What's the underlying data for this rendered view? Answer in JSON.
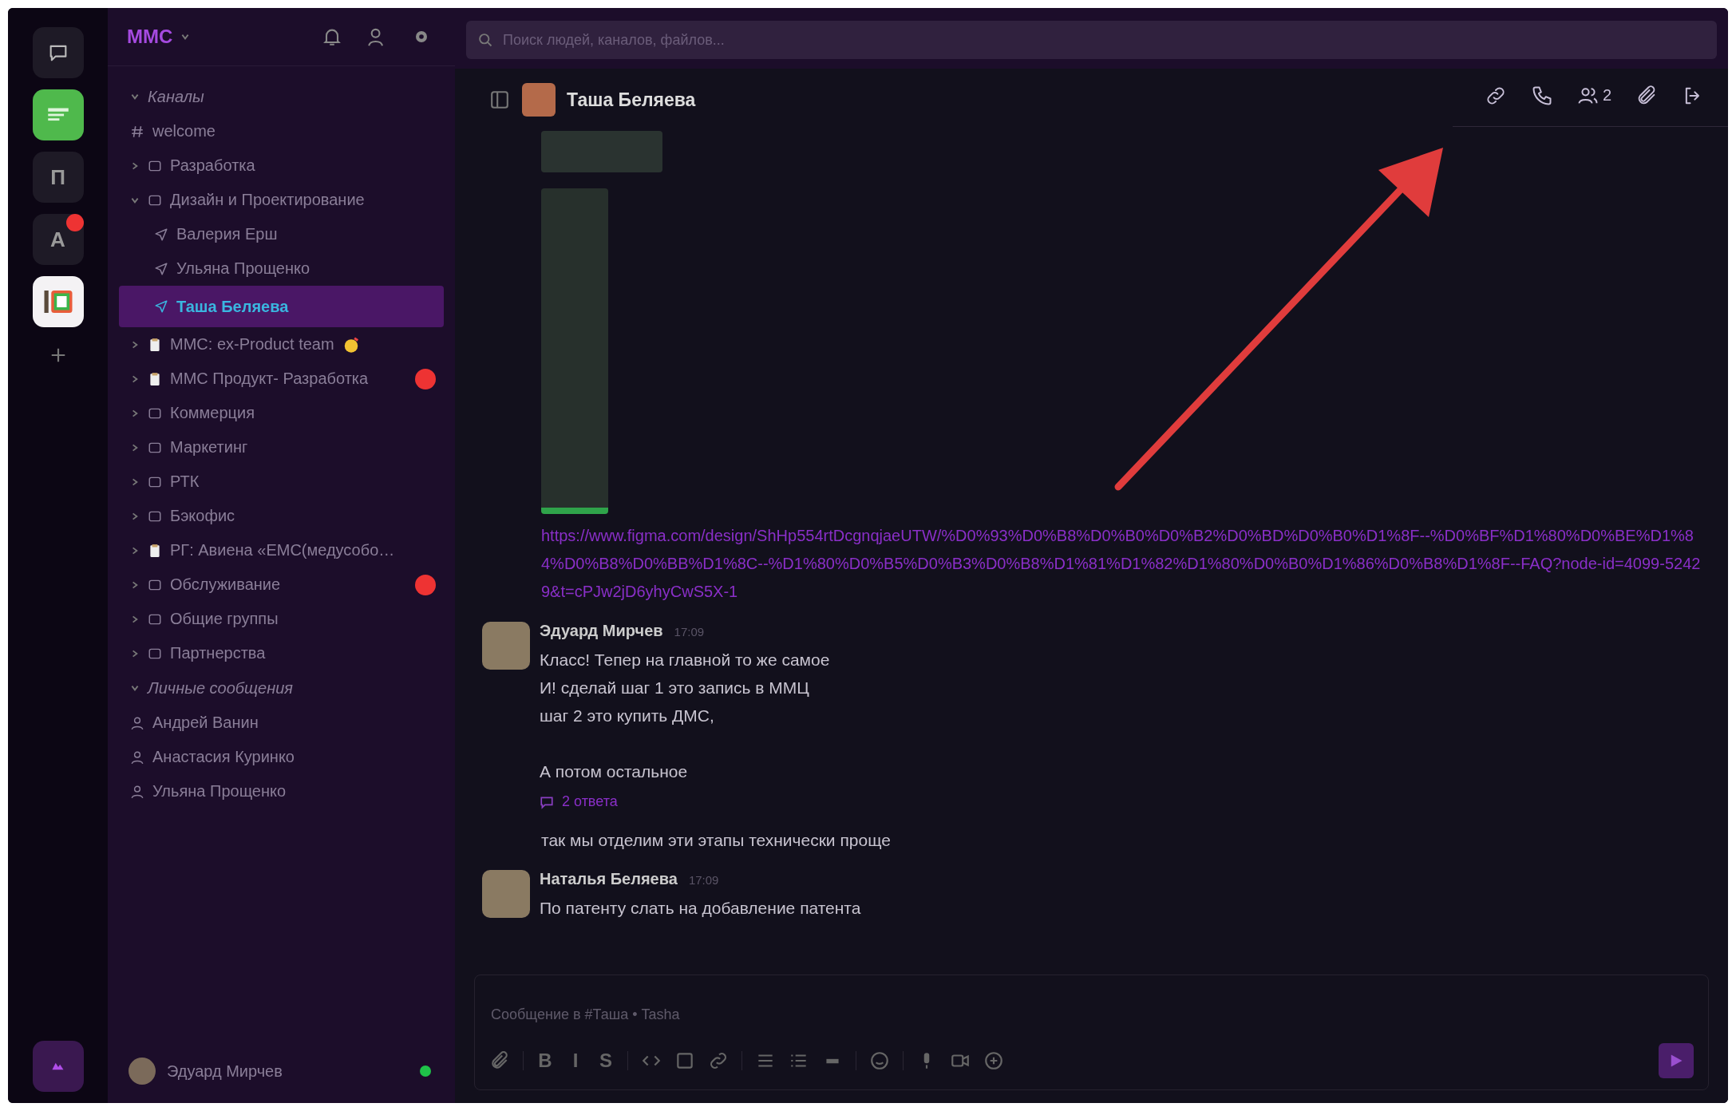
{
  "rail": {
    "items": [
      {
        "kind": "chat",
        "badge": false
      },
      {
        "kind": "green-app",
        "badge": false
      },
      {
        "kind": "letter",
        "label": "П",
        "badge": false
      },
      {
        "kind": "letter",
        "label": "A",
        "badge": true
      },
      {
        "kind": "color-app",
        "badge": false
      },
      {
        "kind": "add",
        "badge": false
      }
    ]
  },
  "sidebar": {
    "team": "MMC",
    "sections": [
      {
        "title": "Каналы",
        "expanded": true,
        "items": [
          {
            "kind": "channel",
            "label": "welcome",
            "selected": false,
            "badge": false,
            "emoji": false
          },
          {
            "kind": "folder",
            "label": "Разработка",
            "expanded": false,
            "selected": false,
            "badge": false,
            "emoji": false
          },
          {
            "kind": "folder",
            "label": "Дизайн и Проектирование",
            "expanded": true,
            "selected": false,
            "badge": false,
            "emoji": false,
            "children": [
              {
                "kind": "dm",
                "label": "Валерия Ерш",
                "selected": false,
                "badge": false,
                "emoji": false
              },
              {
                "kind": "dm",
                "label": "Ульяна Прощенко",
                "selected": false,
                "badge": false,
                "emoji": false
              },
              {
                "kind": "dm",
                "label": "Таша Беляева",
                "selected": true,
                "badge": false,
                "emoji": false
              }
            ]
          },
          {
            "kind": "group",
            "label": "MMC: ex-Product team",
            "expanded": false,
            "selected": false,
            "badge": false,
            "emoji": true
          },
          {
            "kind": "group",
            "label": "MMC Продукт- Разработка",
            "expanded": false,
            "selected": false,
            "badge": true,
            "emoji": false
          },
          {
            "kind": "folder",
            "label": "Коммерция",
            "expanded": false,
            "selected": false,
            "badge": false,
            "emoji": false
          },
          {
            "kind": "folder",
            "label": "Маркетинг",
            "expanded": false,
            "selected": false,
            "badge": false,
            "emoji": false
          },
          {
            "kind": "folder",
            "label": "РТК",
            "expanded": false,
            "selected": false,
            "badge": false,
            "emoji": false
          },
          {
            "kind": "folder",
            "label": "Бэкофис",
            "expanded": false,
            "selected": false,
            "badge": false,
            "emoji": false
          },
          {
            "kind": "group",
            "label": "РГ: Авиена «ЕМС(медусобо…",
            "expanded": false,
            "selected": false,
            "badge": false,
            "emoji": false
          },
          {
            "kind": "folder",
            "label": "Обслуживание",
            "expanded": false,
            "selected": false,
            "badge": true,
            "emoji": false
          },
          {
            "kind": "folder",
            "label": "Общие группы",
            "expanded": false,
            "selected": false,
            "badge": false,
            "emoji": false
          },
          {
            "kind": "folder",
            "label": "Партнерства",
            "expanded": false,
            "selected": false,
            "badge": false,
            "emoji": false
          }
        ]
      },
      {
        "title": "Личные сообщения",
        "expanded": true,
        "items": [
          {
            "kind": "person",
            "label": "Андрей Ванин",
            "selected": false,
            "badge": false,
            "emoji": false
          },
          {
            "kind": "person",
            "label": "Анастасия Куринко",
            "selected": false,
            "badge": false,
            "emoji": false
          },
          {
            "kind": "person",
            "label": "Ульяна Прощенко",
            "selected": false,
            "badge": false,
            "emoji": false
          }
        ]
      }
    ],
    "user": {
      "name": "Эдуард Мирчев",
      "online": true
    }
  },
  "search": {
    "placeholder": "Поиск людей, каналов, файлов..."
  },
  "channel": {
    "title": "Таша Беляева",
    "members": "2"
  },
  "messages": [
    {
      "kind": "thumbnail"
    },
    {
      "kind": "screenshot"
    },
    {
      "kind": "link",
      "text": "https://www.figma.com/design/ShHp554rtDcgnqjaeUTW/%D0%93%D0%B8%D0%B0%D0%B2%D0%BD%D0%B0%D1%8F--%D0%BF%D1%80%D0%BE%D1%84%D0%B8%D0%BB%D1%8C--%D1%80%D0%B5%D0%B3%D0%B8%D1%81%D1%82%D1%80%D0%B0%D1%86%D0%B8%D1%8F--FAQ?node-id=4099-52429&t=cPJw2jD6yhyCwS5X-1"
    },
    {
      "kind": "post",
      "author": "Эдуард Мирчев",
      "time": "17:09",
      "paragraphs": [
        [
          "Класс! Тепер на главной то же самое",
          "И! сделай шаг 1 это запись в ММЦ",
          "шаг 2 это купить ДМС,"
        ],
        [
          "А потом остальное"
        ]
      ],
      "replies": "2 ответа"
    },
    {
      "kind": "text",
      "text": "так мы отделим эти этапы технически проще"
    },
    {
      "kind": "post",
      "author": "Наталья Беляева",
      "time": "17:09",
      "paragraphs": [
        [
          "По патенту слать на добавление патента"
        ]
      ]
    }
  ],
  "composer": {
    "placeholder": "Сообщение в #Таша • Tasha",
    "tools": [
      {
        "kind": "attach"
      },
      {
        "kind": "sep"
      },
      {
        "kind": "glyph",
        "label": "B"
      },
      {
        "kind": "glyph",
        "label": "I"
      },
      {
        "kind": "glyph",
        "label": "S"
      },
      {
        "kind": "sep"
      },
      {
        "kind": "code"
      },
      {
        "kind": "block"
      },
      {
        "kind": "link"
      },
      {
        "kind": "sep"
      },
      {
        "kind": "list"
      },
      {
        "kind": "olist"
      },
      {
        "kind": "rule"
      },
      {
        "kind": "sep"
      },
      {
        "kind": "emoji"
      },
      {
        "kind": "sep"
      },
      {
        "kind": "mic"
      },
      {
        "kind": "video"
      },
      {
        "kind": "plus"
      }
    ]
  }
}
